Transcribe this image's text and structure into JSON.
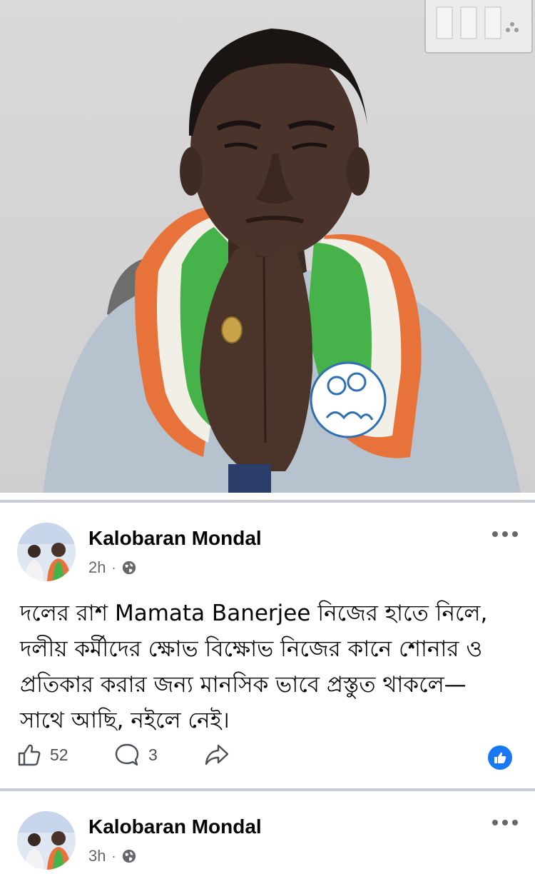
{
  "photo": {
    "subject": "man with folded hands wearing tricolor scarf"
  },
  "posts": [
    {
      "author": "Kalobaran Mondal",
      "time": "2h",
      "separator": "·",
      "privacy_icon": "globe-icon",
      "text_lines": [
        "দলের রাশ Mamata Banerjee নিজের হাতে নিলে,",
        "দলীয় কর্মীদের ক্ষোভ বিক্ষোভ নিজের কানে শোনার ও",
        "প্রতিকার করার জন্য মানসিক ভাবে প্রস্তুত থাকলে—",
        "সাথে আছি, নইলে নেই।"
      ],
      "likes": "52",
      "comments": "3",
      "reaction_icon": "like-reaction-icon"
    },
    {
      "author": "Kalobaran Mondal",
      "time": "3h",
      "separator": "·",
      "privacy_icon": "globe-icon"
    }
  ],
  "colors": {
    "accent": "#1877f2",
    "meta_text": "#65676b",
    "divider": "#c9ccd1"
  }
}
